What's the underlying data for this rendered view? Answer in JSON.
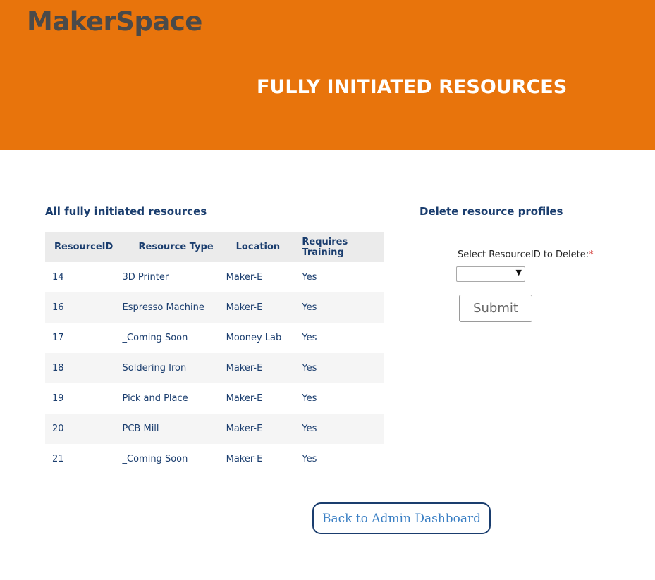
{
  "header": {
    "brand": "MakerSpace",
    "title": "FULLY INITIATED RESOURCES",
    "accent_color": "#e8740c"
  },
  "resources_section": {
    "heading": "All fully initiated resources",
    "columns": [
      "ResourceID",
      "Resource Type",
      "Location",
      "Requires Training"
    ],
    "rows": [
      [
        "14",
        "3D Printer",
        "Maker-E",
        "Yes"
      ],
      [
        "16",
        "Espresso Machine",
        "Maker-E",
        "Yes"
      ],
      [
        "17",
        "_Coming Soon",
        "Mooney Lab",
        "Yes"
      ],
      [
        "18",
        "Soldering Iron",
        "Maker-E",
        "Yes"
      ],
      [
        "19",
        "Pick and Place",
        "Maker-E",
        "Yes"
      ],
      [
        "20",
        "PCB Mill",
        "Maker-E",
        "Yes"
      ],
      [
        "21",
        "_Coming Soon",
        "Maker-E",
        "Yes"
      ]
    ]
  },
  "delete_section": {
    "heading": "Delete resource profiles",
    "label": "Select ResourceID to Delete:",
    "required_mark": "*",
    "selected_value": "",
    "submit_label": "Submit"
  },
  "footer": {
    "back_label": "Back to Admin Dashboard"
  }
}
